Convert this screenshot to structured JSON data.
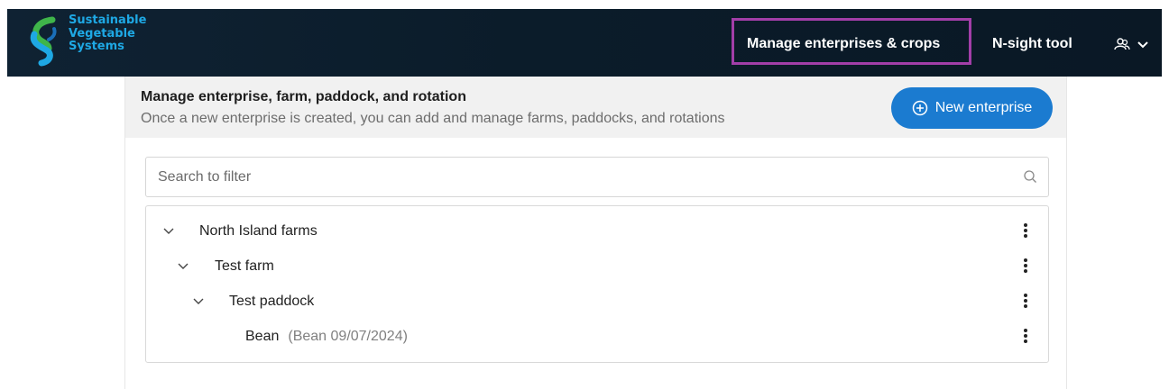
{
  "brand": {
    "lines": [
      "Sustainable",
      "Vegetable",
      "Systems"
    ]
  },
  "nav": {
    "manage_label": "Manage enterprises & crops",
    "nsight_label": "N-sight tool",
    "user_menu_icon": "users-icon"
  },
  "page": {
    "title": "Manage enterprise, farm, paddock, and rotation",
    "subtitle": "Once a new enterprise is created, you can add and manage farms, paddocks, and rotations",
    "new_button_label": "New enterprise"
  },
  "search": {
    "placeholder": "Search to filter",
    "value": ""
  },
  "tree": [
    {
      "label": "North Island farms",
      "detail": "",
      "expanded": true
    },
    {
      "label": "Test farm",
      "detail": "",
      "expanded": true
    },
    {
      "label": "Test paddock",
      "detail": "",
      "expanded": true
    },
    {
      "label": "Bean",
      "detail": "(Bean 09/07/2024)",
      "expanded": null
    }
  ],
  "colors": {
    "topbar": "#0f2233",
    "brand_text": "#1ea8e4",
    "highlight": "#a23ea8",
    "primary_button": "#1b7bd0",
    "header_bg": "#f1f1f1"
  }
}
